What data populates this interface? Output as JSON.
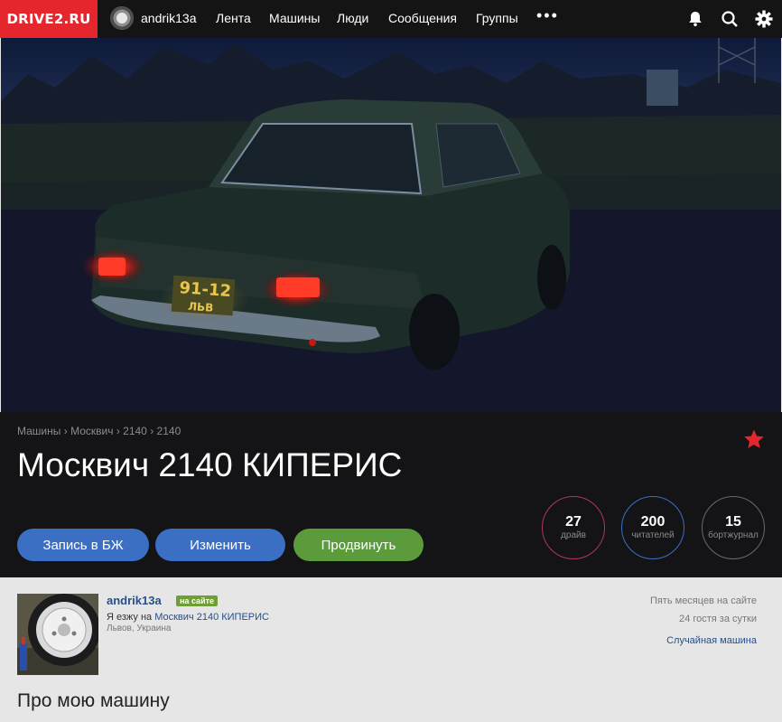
{
  "topbar": {
    "logo": "DRIVE2.RU",
    "user": "andrik13a",
    "nav": [
      "Лента",
      "Машины",
      "Люди",
      "Сообщения",
      "Группы"
    ],
    "more": "•••",
    "icons": [
      "bell-icon",
      "search-icon",
      "gear-icon"
    ]
  },
  "hero": {
    "plate": "91-12",
    "plate_sub": "ЛЬВ"
  },
  "breadcrumb": {
    "items": [
      "Машины",
      "Москвич",
      "2140",
      "2140"
    ],
    "sep": "›"
  },
  "car": {
    "title": "Москвич 2140 КИПЕРИС"
  },
  "buttons": {
    "journal": "Запись в БЖ",
    "edit": "Изменить",
    "promote": "Продвинуть"
  },
  "stats": [
    {
      "value": "27",
      "label": "драйв"
    },
    {
      "value": "200",
      "label": "читателей"
    },
    {
      "value": "15",
      "label": "бортжурнал"
    }
  ],
  "owner": {
    "name": "andrik13a",
    "status": "на сайте",
    "drives_prefix": "Я езжу на",
    "drives_car": "Москвич 2140 КИПЕРИС",
    "location": "Львов, Украина",
    "since": "Пять месяцев на сайте",
    "guests": "24 гостя за сутки",
    "random_car": "Случайная машина"
  },
  "section": {
    "about": "Про мою машину"
  },
  "colors": {
    "brand": "#e5262c",
    "button_blue": "#3a6fc4",
    "button_green": "#5c9b3b",
    "star": "#e5262c",
    "stat_pink": "#b0365f",
    "stat_blue": "#3a6fc4",
    "stat_gray": "#6a6a6a"
  }
}
